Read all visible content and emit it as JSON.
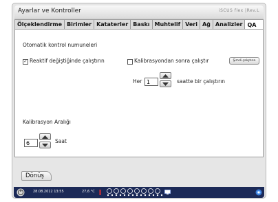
{
  "window": {
    "title": "Ayarlar ve Kontroller",
    "brand": "iSCUS flex  |Rev.L"
  },
  "tabs": [
    {
      "label": "Ölçeklendirme"
    },
    {
      "label": "Birimler"
    },
    {
      "label": "Kataterler"
    },
    {
      "label": "Baskı"
    },
    {
      "label": "Muhtelif"
    },
    {
      "label": "Veri"
    },
    {
      "label": "Ağ"
    },
    {
      "label": "Analizler"
    },
    {
      "label": "QA"
    }
  ],
  "qa": {
    "section_title": "Otomatik kontrol numuneleri",
    "reactive_label": "Reaktif değiştiğinde çalıştırın",
    "reactive_checked": true,
    "calib_label": "Kalibrasyondan sonra çalıştır",
    "calib_checked": false,
    "run_now_label": "Şimdi çalıştırın",
    "every_prefix": "Her",
    "every_value": "1",
    "every_suffix": "saatte bir çalıştırın",
    "interval_label": "Kalibrasyon Aralığı",
    "interval_value": "6",
    "interval_unit": "Saat"
  },
  "back_label": "Dönüş",
  "status": {
    "datetime": "28.08.2012  13:55",
    "temperature": "27,6 °C"
  }
}
